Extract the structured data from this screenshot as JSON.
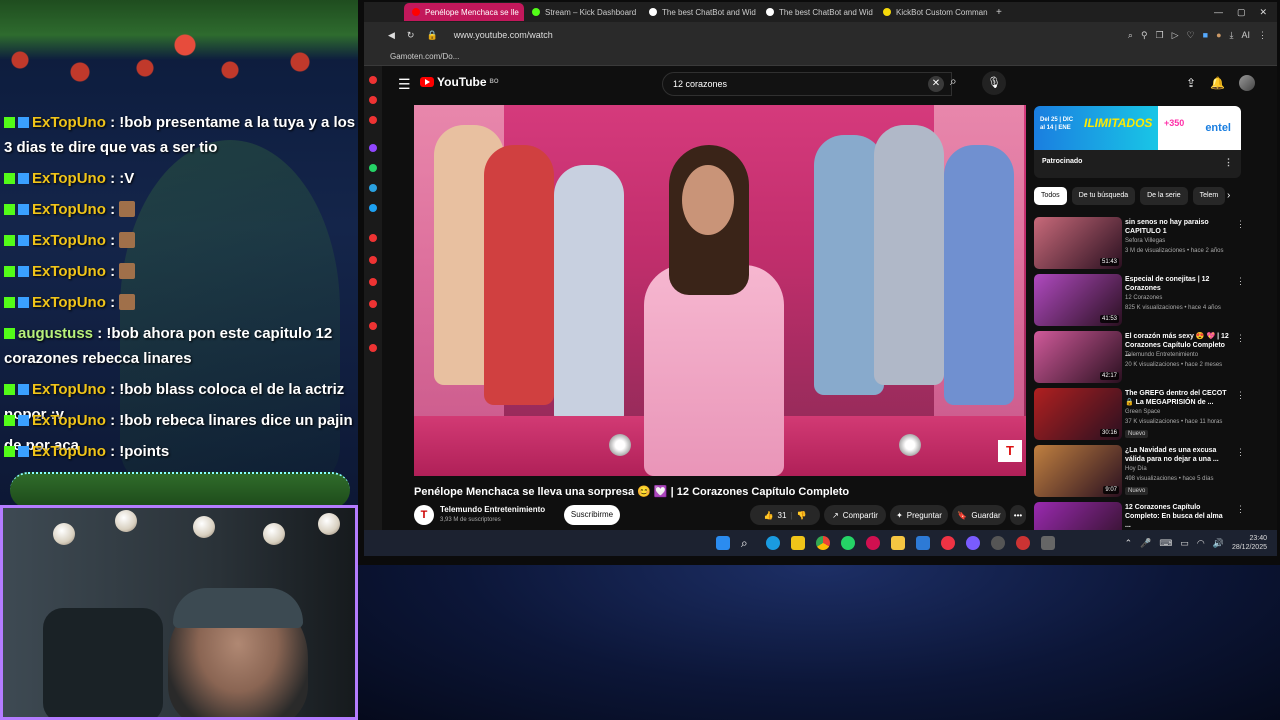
{
  "chat": {
    "messages": [
      {
        "user": "ExTopUno",
        "text": ": !bob presentame a la tuya y a los 3 dias te dire que vas a ser tio",
        "emote": false
      },
      {
        "user": "ExTopUno",
        "text": ": :V",
        "emote": false
      },
      {
        "user": "ExTopUno",
        "text": ":",
        "emote": true
      },
      {
        "user": "ExTopUno",
        "text": ":",
        "emote": true
      },
      {
        "user": "ExTopUno",
        "text": ":",
        "emote": true
      },
      {
        "user": "ExTopUno",
        "text": ":",
        "emote": true
      },
      {
        "user": "augustuss",
        "text": ": !bob ahora pon este capitulo 12 corazones rebecca linares",
        "emote": false
      },
      {
        "user": "ExTopUno",
        "text": ": !bob blass coloca el de la actriz nopor :v",
        "emote": false
      },
      {
        "user": "ExTopUno",
        "text": ": !bob rebeca linares dice un pajin de por aca",
        "emote": false
      },
      {
        "user": "ExTopUno",
        "text": ": !points",
        "emote": false
      }
    ]
  },
  "browser": {
    "tabs": [
      {
        "title": "Penélope Menchaca se lle",
        "active": true,
        "color": "#ff0000"
      },
      {
        "title": "Stream – Kick Dashboard",
        "active": false,
        "color": "#53fc18"
      },
      {
        "title": "The best ChatBot and Wid",
        "active": false,
        "color": "#ffffff"
      },
      {
        "title": "The best ChatBot and Wid",
        "active": false,
        "color": "#ffffff"
      },
      {
        "title": "KickBot Custom Comman",
        "active": false,
        "color": "#f5d90a"
      }
    ],
    "new_tab": "+",
    "url": "www.youtube.com/watch",
    "bookmark": "Gamoten.com/Do...",
    "ai_label": "AI"
  },
  "youtube": {
    "logo": "YouTube",
    "country": "BO",
    "search_query": "12 corazones",
    "video_title": "Penélope Menchaca se lleva una sorpresa 😊 💟 | 12 Corazones Capítulo Completo",
    "channel_name": "Telemundo Entretenimiento",
    "channel_subs": "3,93 M de suscriptores",
    "subscribe_label": "Suscribirme",
    "likes": "31",
    "share_label": "Compartir",
    "ask_label": "Preguntar",
    "save_label": "Guardar",
    "more_label": "•••",
    "ad": {
      "date_line1": "Del 25 | DIC",
      "date_line2": "al 14 | ENE",
      "title": "ILIMITADOS",
      "promo": "+350",
      "brand": "entel",
      "sponsored": "Patrocinado"
    },
    "chips": [
      "Todos",
      "De tu búsqueda",
      "De la serie",
      "Telem"
    ],
    "recommendations": [
      {
        "title": "sin senos no hay paraiso CAPITULO 1",
        "channel": "Sefora Villegas",
        "stats": "3 M de visualizaciones • hace 2 años",
        "duration": "51:43",
        "badge": "",
        "thumb": "#c86a7a"
      },
      {
        "title": "Especial de conejitas | 12 Corazones",
        "channel": "12 Corazones",
        "stats": "825 K visualizaciones • hace 4 años",
        "duration": "41:53",
        "badge": "",
        "thumb": "#b04ac0"
      },
      {
        "title": "El corazón más sexy 😍 💖 | 12 Corazones Capítulo Completo ...",
        "channel": "Telemundo Entretenimiento",
        "stats": "20 K visualizaciones • hace 2 meses",
        "duration": "42:17",
        "badge": "",
        "thumb": "#d05a9a"
      },
      {
        "title": "The GREFG dentro del CECOT 🔒 La MEGAPRISIÓN de ...",
        "channel": "Green Space",
        "stats": "37 K visualizaciones • hace 11 horas",
        "duration": "30:16",
        "badge": "Nuevo",
        "thumb": "#b02020"
      },
      {
        "title": "¿La Navidad es una excusa válida para no dejar a una ...",
        "channel": "Hoy Día",
        "stats": "498 visualizaciones • hace 5 días",
        "duration": "9:07",
        "badge": "Nuevo",
        "thumb": "#c08040"
      },
      {
        "title": "12 Corazones Capítulo Completo: En busca del alma ...",
        "channel": "",
        "stats": "",
        "duration": "",
        "badge": "",
        "thumb": "#9a2ab0"
      }
    ]
  },
  "taskbar": {
    "time": "23:40",
    "date": "28/12/2025"
  }
}
